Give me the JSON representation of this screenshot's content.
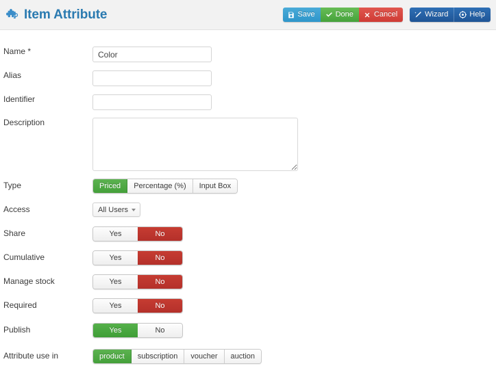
{
  "header": {
    "icon": "puzzle-piece-icon",
    "title": "Item Attribute",
    "brand_color": "#2a7ab0"
  },
  "toolbar": {
    "buttons": [
      {
        "label": "Save",
        "icon": "floppy-disk-icon",
        "color": "#2e96ca"
      },
      {
        "label": "Done",
        "icon": "check-icon",
        "color": "#45a23b"
      },
      {
        "label": "Cancel",
        "icon": "cross-icon",
        "color": "#cf3b35"
      },
      {
        "label": "Wizard",
        "icon": "magic-wand-icon",
        "color": "#1f5596"
      },
      {
        "label": "Help",
        "icon": "help-compass-icon",
        "color": "#1f5596"
      }
    ]
  },
  "form": {
    "name": {
      "label": "Name *",
      "value": "Color",
      "placeholder": ""
    },
    "alias": {
      "label": "Alias",
      "value": "",
      "placeholder": ""
    },
    "identifier": {
      "label": "Identifier",
      "value": "",
      "placeholder": ""
    },
    "description": {
      "label": "Description",
      "value": "",
      "placeholder": ""
    },
    "type": {
      "label": "Type",
      "options": [
        "Priced",
        "Percentage (%)",
        "Input Box"
      ],
      "selected": "Priced"
    },
    "access": {
      "label": "Access",
      "selected": "All Users",
      "options": [
        "All Users"
      ]
    },
    "share": {
      "label": "Share",
      "yes_label": "Yes",
      "no_label": "No",
      "value": "No"
    },
    "cumulative": {
      "label": "Cumulative",
      "yes_label": "Yes",
      "no_label": "No",
      "value": "No"
    },
    "manage_stock": {
      "label": "Manage stock",
      "yes_label": "Yes",
      "no_label": "No",
      "value": "No"
    },
    "required": {
      "label": "Required",
      "yes_label": "Yes",
      "no_label": "No",
      "value": "No"
    },
    "publish": {
      "label": "Publish",
      "yes_label": "Yes",
      "no_label": "No",
      "value": "Yes"
    },
    "attribute_use_in": {
      "label": "Attribute use in",
      "options": [
        "product",
        "subscription",
        "voucher",
        "auction"
      ],
      "selected": "product"
    }
  }
}
